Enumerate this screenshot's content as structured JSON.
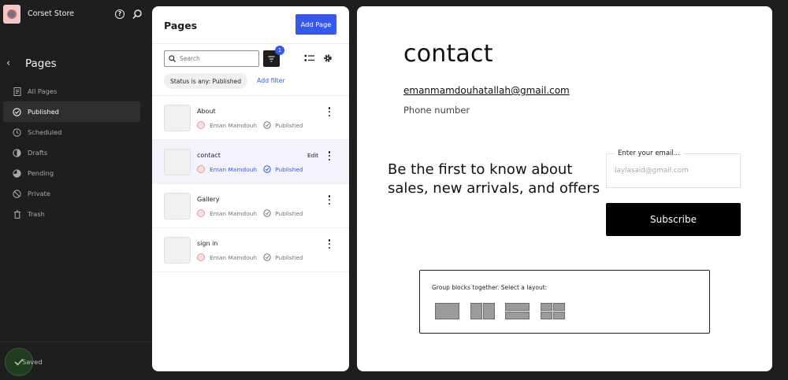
{
  "site": {
    "name": "Corset Store"
  },
  "sidebar": {
    "title": "Pages",
    "items": [
      {
        "label": "All Pages",
        "icon": "document-icon"
      },
      {
        "label": "Published",
        "icon": "check-circle-icon",
        "active": true
      },
      {
        "label": "Scheduled",
        "icon": "clock-icon"
      },
      {
        "label": "Drafts",
        "icon": "drafts-icon"
      },
      {
        "label": "Pending",
        "icon": "pending-icon"
      },
      {
        "label": "Private",
        "icon": "private-icon"
      },
      {
        "label": "Trash",
        "icon": "trash-icon"
      }
    ],
    "saved_label": "Saved"
  },
  "panel": {
    "title": "Pages",
    "add_label": "Add Page",
    "search_placeholder": "Search",
    "filter_count": "1",
    "status_chip": "Status is any: Published",
    "add_filter": "Add filter",
    "edit_label": "Edit",
    "rows": [
      {
        "title": "About",
        "author": "Eman Mamdouh",
        "status": "Published"
      },
      {
        "title": "contact",
        "author": "Eman Mamdouh",
        "status": "Published"
      },
      {
        "title": "Gallery",
        "author": "Eman Mamdouh",
        "status": "Published"
      },
      {
        "title": "sign in",
        "author": "Eman Mamdouh",
        "status": "Published"
      }
    ]
  },
  "canvas": {
    "title": "contact",
    "email": "emanmamdouhatallah@gmail.com",
    "phone": "Phone number",
    "headline": "Be the first to know about sales, new arrivals, and offers",
    "email_label": "Enter your email...",
    "email_placeholder": "laylasaid@gmail.com",
    "subscribe": "Subscribe",
    "group_label": "Group blocks together. Select a layout:"
  },
  "colors": {
    "accent": "#3858e9",
    "sidebar_bg": "#1e1e1e"
  }
}
